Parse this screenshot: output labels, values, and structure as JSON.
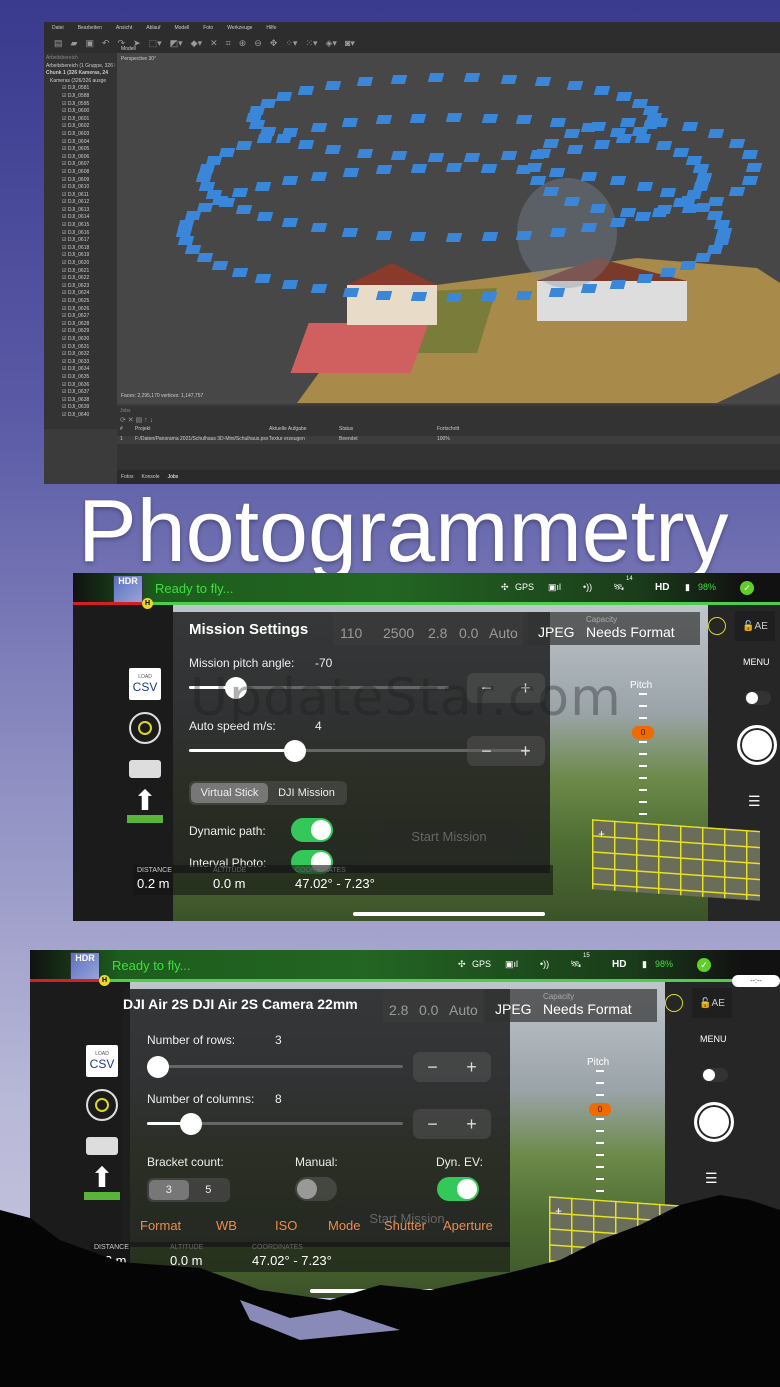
{
  "metashape": {
    "menu": [
      "Datei",
      "Bearbeiten",
      "Ansicht",
      "Ablauf",
      "Modell",
      "Foto",
      "Werkzeuge",
      "Hilfe"
    ],
    "workspace_label": "Arbeitsbereich",
    "tree_root": "Arbeitsbereich (1 Gruppe, 326 K",
    "chunk": "Chunk 1 (326 Kameras, 24",
    "cameras_folder": "Kameras (326/326 ausge",
    "photos": [
      "DJI_0581",
      "DJI_0588",
      "DJI_0595",
      "DJI_0600",
      "DJI_0601",
      "DJI_0602",
      "DJI_0603",
      "DJI_0604",
      "DJI_0605",
      "DJI_0606",
      "DJI_0607",
      "DJI_0608",
      "DJI_0609",
      "DJI_0610",
      "DJI_0611",
      "DJI_0612",
      "DJI_0613",
      "DJI_0614",
      "DJI_0615",
      "DJI_0616",
      "DJI_0617",
      "DJI_0618",
      "DJI_0619",
      "DJI_0620",
      "DJI_0621",
      "DJI_0622",
      "DJI_0623",
      "DJI_0624",
      "DJI_0625",
      "DJI_0626",
      "DJI_0627",
      "DJI_0628",
      "DJI_0629",
      "DJI_0630",
      "DJI_0631",
      "DJI_0632",
      "DJI_0633",
      "DJI_0634",
      "DJI_0635",
      "DJI_0636",
      "DJI_0637",
      "DJI_0638",
      "DJI_0639",
      "DJI_0640"
    ],
    "view_tab": "Modell",
    "view_label": "Perspective 30°",
    "model_stats": "Faces: 2,295,170 vertices: 1,147,757",
    "jobs_label": "Jobs",
    "jobs_columns": [
      "#",
      "Projekt",
      "Aktuelle Aufgabe",
      "Status",
      "Fortschritt"
    ],
    "jobs_rows": [
      [
        "1",
        "F:/Daten/Panorama 2021/Schulhaus 3D-Mini/Schulhaus.psx",
        "Textur erzeugen",
        "Beendet",
        "100%"
      ]
    ],
    "bottom_tabs": [
      "Fotos",
      "Konsole",
      "Jobs"
    ]
  },
  "headline": "Photogrammetry",
  "watermark": "UpdateStar.com",
  "status_bar": {
    "hdr_badge": "HDR",
    "ready": "Ready to fly...",
    "gps": "GPS",
    "sat_count_1": "14",
    "sat_count_2": "15",
    "hd": "HD",
    "battery": "98%",
    "home_marker": "H"
  },
  "camera_strip": {
    "values": [
      "110",
      "2500",
      "2.8",
      "0.0",
      "Auto"
    ],
    "format": "JPEG",
    "capacity_label": "Capacity",
    "capacity_value": "Needs Format",
    "ae": "AE",
    "menu": "MENU",
    "pitch": "Pitch",
    "pitch_value": "0"
  },
  "left_tools": {
    "load": "LOAD",
    "csv": "CSV"
  },
  "telemetry": {
    "distance_label": "DISTANCE",
    "distance": "0.2 m",
    "altitude_label": "ALTITUDE",
    "altitude": "0.0 m",
    "coords_label": "COORDINATES",
    "coords": "47.02° - 7.23°"
  },
  "mission": {
    "title": "Mission Settings",
    "pitch_label": "Mission pitch angle:",
    "pitch_value": "-70",
    "pitch_fraction": 0.15,
    "speed_label": "Auto speed m/s:",
    "speed_value": "4",
    "speed_fraction": 0.3,
    "modes": [
      "Virtual Stick",
      "DJI Mission"
    ],
    "selected_mode": "Virtual Stick",
    "dynamic_path_label": "Dynamic path:",
    "dynamic_path": true,
    "interval_photo_label": "Interval Photo:",
    "interval_photo": true,
    "start": "Start Mission",
    "minus": "−",
    "plus": "+"
  },
  "panorama": {
    "title": "DJI Air 2S DJI Air 2S Camera 22mm",
    "rows_label": "Number of rows:",
    "rows_value": "3",
    "rows_fraction": 0.0,
    "cols_label": "Number of columns:",
    "cols_value": "8",
    "cols_fraction": 0.14,
    "bracket_label": "Bracket count:",
    "bracket_options": [
      "3",
      "5"
    ],
    "bracket_selected": "3",
    "manual_label": "Manual:",
    "manual": false,
    "dyn_ev_label": "Dyn. EV:",
    "dyn_ev": true,
    "settings_tabs": [
      "Format",
      "WB",
      "ISO",
      "Mode",
      "Shutter",
      "Aperture"
    ],
    "start": "Start Mission",
    "time_pill": "--:--"
  },
  "colors": {
    "green": "#34c759",
    "ready_green": "#3ee03e",
    "orange": "#f08a4b",
    "camera_blue": "#3a86d8"
  }
}
